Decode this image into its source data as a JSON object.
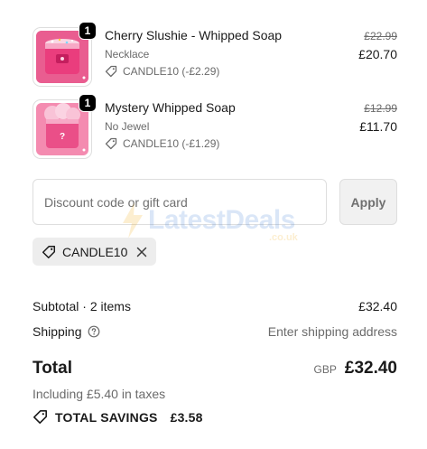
{
  "items": [
    {
      "quantity": "1",
      "name": "Cherry Slushie - Whipped Soap",
      "variant": "Necklace",
      "discount": "CANDLE10 (-£2.29)",
      "compare_price": "£22.99",
      "price": "£20.70",
      "image": "pink soap jar with sprinkles"
    },
    {
      "quantity": "1",
      "name": "Mystery Whipped Soap",
      "variant": "No Jewel",
      "discount": "CANDLE10 (-£1.29)",
      "compare_price": "£12.99",
      "price": "£11.70",
      "image": "pink whipped soap jar with question mark"
    }
  ],
  "discount_form": {
    "placeholder": "Discount code or gift card",
    "value": "",
    "apply_label": "Apply"
  },
  "applied_code": {
    "code": "CANDLE10",
    "remove_icon": "close-icon"
  },
  "summary": {
    "subtotal_label": "Subtotal · 2 items",
    "subtotal_value": "£32.40",
    "shipping_label": "Shipping",
    "shipping_value": "Enter shipping address",
    "total_label": "Total",
    "currency": "GBP",
    "total_value": "£32.40",
    "taxes_note": "Including £5.40 in taxes",
    "savings_label": "TOTAL SAVINGS",
    "savings_value": "£3.58"
  },
  "watermark": {
    "text": "LatestDeals",
    "sub": ".co.uk"
  },
  "colors": {
    "brand_pink": "#e8407a",
    "border": "#dedede",
    "muted_text": "#6b6b6b",
    "chip_bg": "#ededed"
  }
}
